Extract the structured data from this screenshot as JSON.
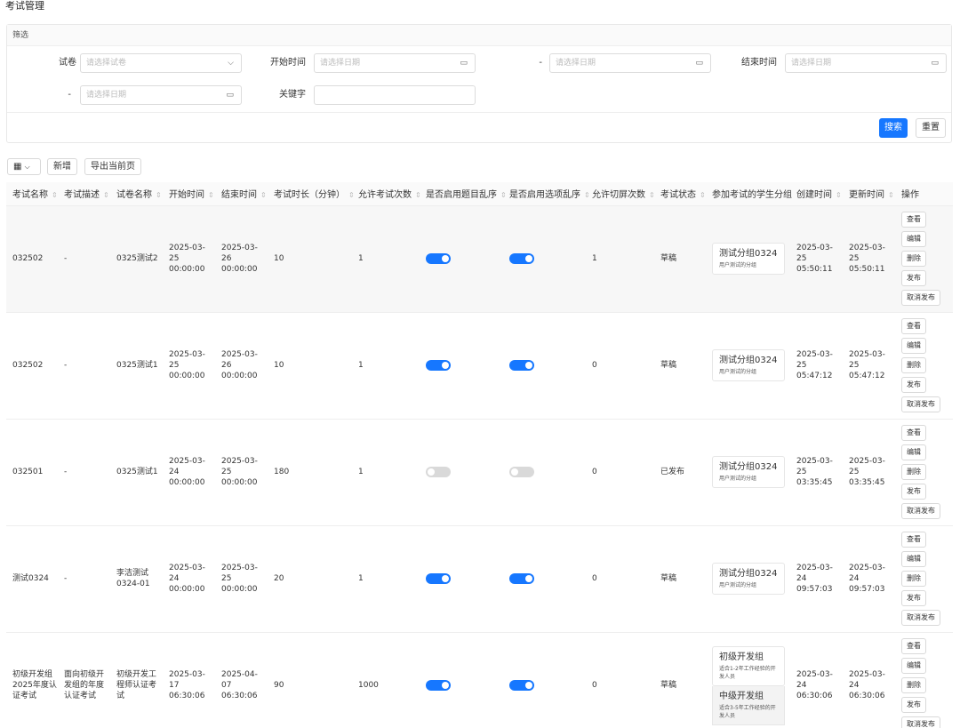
{
  "page": {
    "title": "考试管理"
  },
  "filter": {
    "header": "筛选",
    "paper_label": "试卷",
    "paper_placeholder": "请选择试卷",
    "start_label": "开始时间",
    "start_from_placeholder": "请选择日期",
    "range_sep": "-",
    "start_to_placeholder": "请选择日期",
    "end_label": "结束时间",
    "end_from_placeholder": "请选择日期",
    "end_to_placeholder": "请选择日期",
    "keyword_label": "关键字",
    "keyword_value": "",
    "search_label": "搜索",
    "reset_label": "重置"
  },
  "toolbar": {
    "columns_icon": "grid-icon",
    "add_label": "新增",
    "export_label": "导出当前页"
  },
  "table": {
    "headers": [
      "考试名称",
      "考试描述",
      "试卷名称",
      "开始时间",
      "结束时间",
      "考试时长（分钟）",
      "允许考试次数",
      "是否启用题目乱序",
      "是否启用选项乱序",
      "允许切屏次数",
      "考试状态",
      "参加考试的学生分组",
      "创建时间",
      "更新时间",
      "操作"
    ],
    "ops": [
      "查看",
      "编辑",
      "删除",
      "发布",
      "取消发布"
    ],
    "rows": [
      {
        "name": "032502",
        "desc": "-",
        "paper": "0325测试2",
        "start_date": "2025-03-25",
        "start_time": "00:00:00",
        "end_date": "2025-03-26",
        "end_time": "00:00:00",
        "duration": "10",
        "attempts": "1",
        "shuffle_q": true,
        "shuffle_o": true,
        "switch_limit": "1",
        "status": "草稿",
        "groups": [
          {
            "name": "测试分组0324",
            "desc": "用户测试的分组"
          }
        ],
        "created_date": "2025-03-25",
        "created_time": "05:50:11",
        "updated_date": "2025-03-25",
        "updated_time": "05:50:11"
      },
      {
        "name": "032502",
        "desc": "-",
        "paper": "0325测试1",
        "start_date": "2025-03-25",
        "start_time": "00:00:00",
        "end_date": "2025-03-26",
        "end_time": "00:00:00",
        "duration": "10",
        "attempts": "1",
        "shuffle_q": true,
        "shuffle_o": true,
        "switch_limit": "0",
        "status": "草稿",
        "groups": [
          {
            "name": "测试分组0324",
            "desc": "用户测试的分组"
          }
        ],
        "created_date": "2025-03-25",
        "created_time": "05:47:12",
        "updated_date": "2025-03-25",
        "updated_time": "05:47:12"
      },
      {
        "name": "032501",
        "desc": "-",
        "paper": "0325测试1",
        "start_date": "2025-03-24",
        "start_time": "00:00:00",
        "end_date": "2025-03-25",
        "end_time": "00:00:00",
        "duration": "180",
        "attempts": "1",
        "shuffle_q": false,
        "shuffle_o": false,
        "switch_limit": "0",
        "status": "已发布",
        "groups": [
          {
            "name": "测试分组0324",
            "desc": "用户测试的分组"
          }
        ],
        "created_date": "2025-03-25",
        "created_time": "03:35:45",
        "updated_date": "2025-03-25",
        "updated_time": "03:35:45"
      },
      {
        "name": "测试0324",
        "desc": "-",
        "paper": "李洁测试0324-01",
        "start_date": "2025-03-24",
        "start_time": "00:00:00",
        "end_date": "2025-03-25",
        "end_time": "00:00:00",
        "duration": "20",
        "attempts": "1",
        "shuffle_q": true,
        "shuffle_o": true,
        "switch_limit": "0",
        "status": "草稿",
        "groups": [
          {
            "name": "测试分组0324",
            "desc": "用户测试的分组"
          }
        ],
        "created_date": "2025-03-24",
        "created_time": "09:57:03",
        "updated_date": "2025-03-24",
        "updated_time": "09:57:03"
      },
      {
        "name": "初级开发组2025年度认证考试",
        "desc": "面向初级开发组的年度认证考试",
        "paper": "初级开发工程师认证考试",
        "start_date": "2025-03-17",
        "start_time": "06:30:06",
        "end_date": "2025-04-07",
        "end_time": "06:30:06",
        "duration": "90",
        "attempts": "1000",
        "shuffle_q": true,
        "shuffle_o": true,
        "switch_limit": "0",
        "status": "草稿",
        "groups": [
          {
            "name": "初级开发组",
            "desc": "适合1-2年工作经验的开发人员"
          },
          {
            "name": "中级开发组",
            "desc": "适合3-5年工作经验的开发人员"
          }
        ],
        "created_date": "2025-03-24",
        "created_time": "06:30:06",
        "updated_date": "2025-03-24",
        "updated_time": "06:30:06"
      }
    ]
  }
}
